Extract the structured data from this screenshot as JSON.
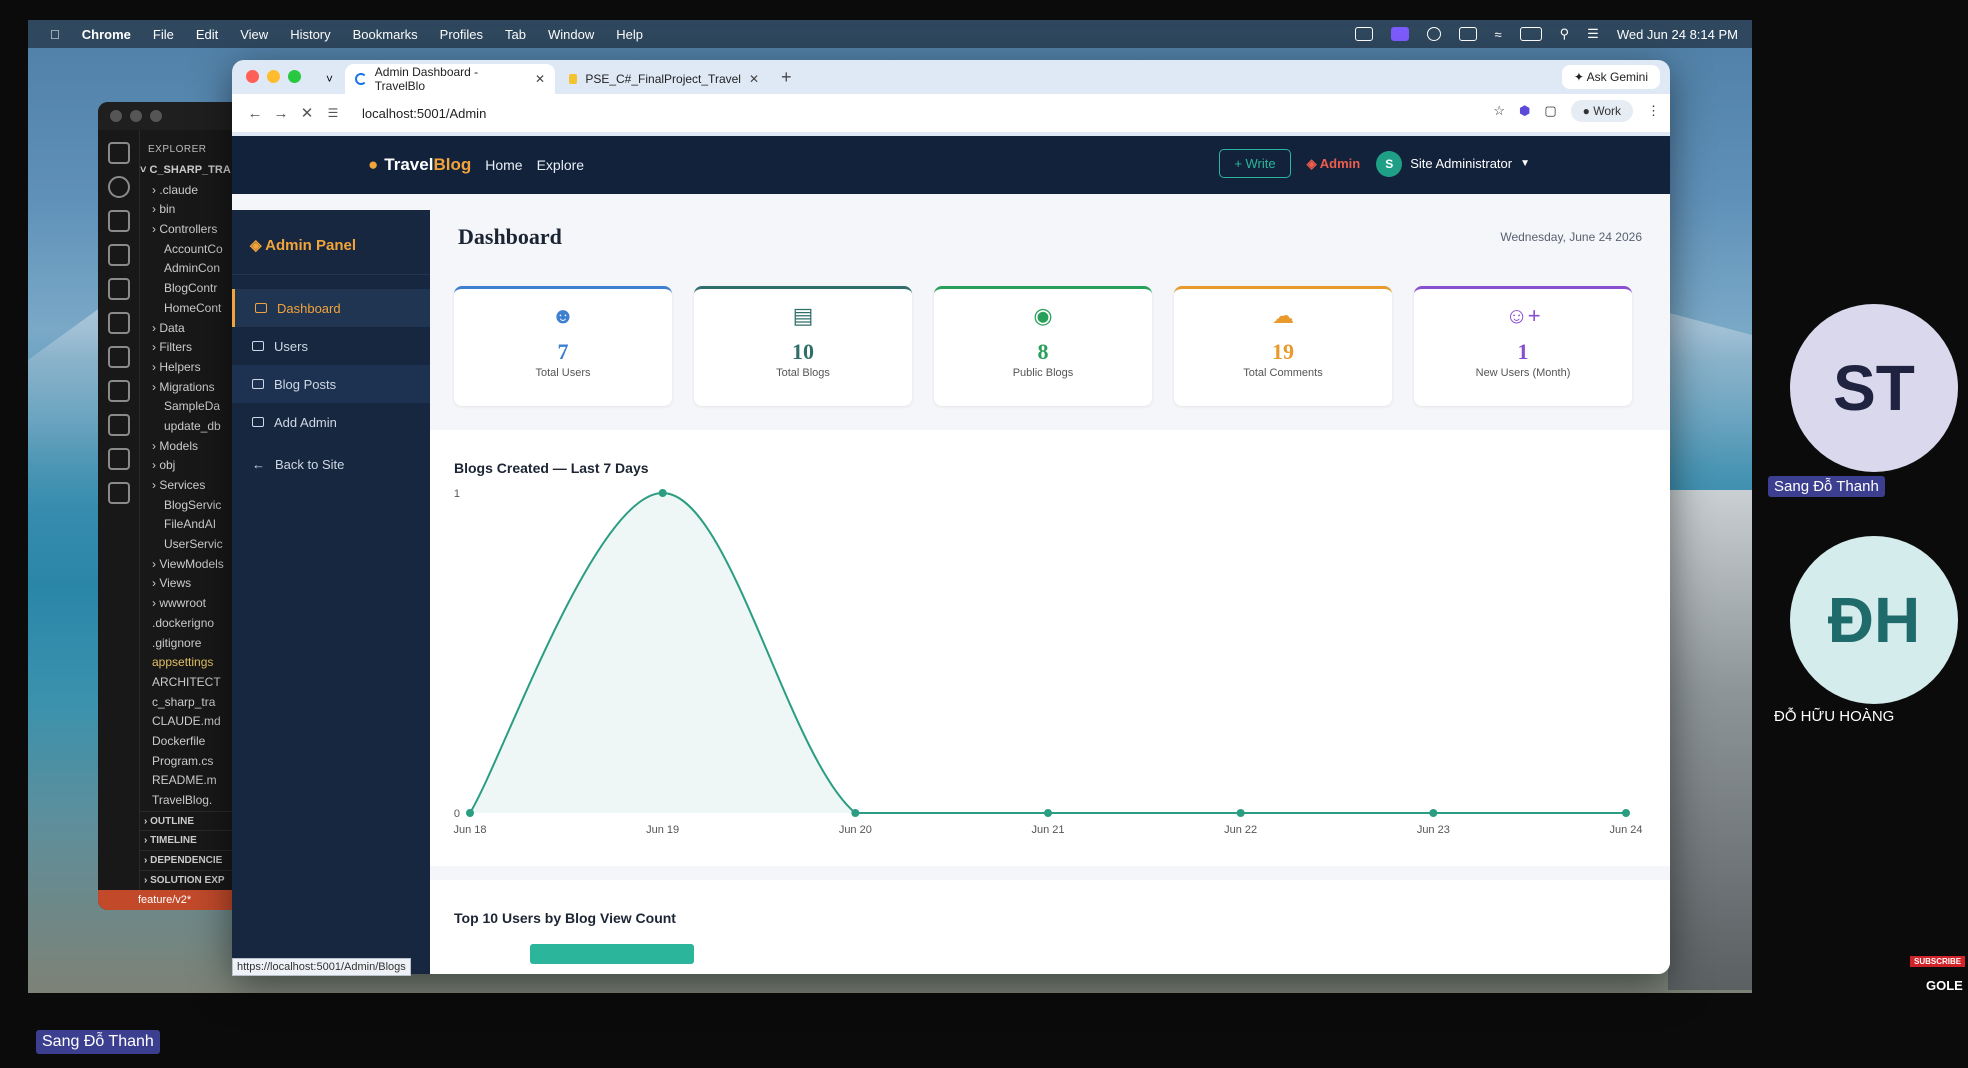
{
  "menubar": {
    "app": "Chrome",
    "items": [
      "File",
      "Edit",
      "View",
      "History",
      "Bookmarks",
      "Profiles",
      "Tab",
      "Window",
      "Help"
    ],
    "datetime": "Wed Jun 24  8:14 PM"
  },
  "vscode": {
    "explorer_label": "EXPLORER",
    "root": "C_SHARP_TRA",
    "items": [
      ".claude",
      "bin",
      "Controllers",
      "AccountCo",
      "AdminCon",
      "BlogContr",
      "HomeCont",
      "Data",
      "Filters",
      "Helpers",
      "Migrations",
      "SampleDa",
      "update_db",
      "Models",
      "obj",
      "Services",
      "BlogServic",
      "FileAndAI",
      "UserServic",
      "ViewModels",
      "Views",
      "wwwroot",
      ".dockerigno",
      ".gitignore",
      "appsettings",
      "ARCHITECT",
      "c_sharp_tra",
      "CLAUDE.md",
      "Dockerfile",
      "Program.cs",
      "README.m",
      "TravelBlog."
    ],
    "sections": [
      "OUTLINE",
      "TIMELINE",
      "DEPENDENCIE",
      "SOLUTION EXP"
    ],
    "branch": "feature/v2*"
  },
  "chrome": {
    "tabs": [
      {
        "label": "Admin Dashboard - TravelBlo"
      },
      {
        "label": "PSE_C#_FinalProject_Travel"
      }
    ],
    "ask_gemini": "Ask Gemini",
    "url": "localhost:5001/Admin",
    "profile": "Work",
    "status_url": "https://localhost:5001/Admin/Blogs"
  },
  "site": {
    "logo_travel": "Travel",
    "logo_blog": "Blog",
    "nav": [
      "Home",
      "Explore"
    ],
    "write": "+ Write",
    "admin": "Admin",
    "avatar_initial": "S",
    "user": "Site Administrator"
  },
  "sidebar": {
    "title": "Admin Panel",
    "items": [
      {
        "label": "Dashboard"
      },
      {
        "label": "Users"
      },
      {
        "label": "Blog Posts"
      },
      {
        "label": "Add Admin"
      },
      {
        "label": "Back to Site"
      }
    ]
  },
  "dashboard": {
    "title": "Dashboard",
    "date": "Wednesday, June 24 2026",
    "cards": [
      {
        "value": "7",
        "label": "Total Users",
        "color": "#3f7fd0"
      },
      {
        "value": "10",
        "label": "Total Blogs",
        "color": "#2f6e6a"
      },
      {
        "value": "8",
        "label": "Public Blogs",
        "color": "#27a05a"
      },
      {
        "value": "19",
        "label": "Total Comments",
        "color": "#e89a2c"
      },
      {
        "value": "1",
        "label": "New Users (Month)",
        "color": "#8a4fd0"
      }
    ],
    "top_users_title": "Top 10 Users by Blog View Count"
  },
  "chart_data": {
    "type": "area",
    "title": "Blogs Created — Last 7 Days",
    "categories": [
      "Jun 18",
      "Jun 19",
      "Jun 20",
      "Jun 21",
      "Jun 22",
      "Jun 23",
      "Jun 24"
    ],
    "values": [
      0,
      1,
      0,
      0,
      0,
      0,
      0
    ],
    "ylim": [
      0,
      1
    ],
    "yticks": [
      "0",
      "1"
    ],
    "color": "#2a9d82",
    "grid": false
  },
  "participants": [
    {
      "initials": "ST",
      "name": "Sang Đỗ Thanh"
    },
    {
      "initials": "ĐH",
      "name": "ĐỖ HỮU HOÀNG"
    }
  ],
  "bottom_name": "Sang Đỗ Thanh",
  "watermark": {
    "subscribe": "SUBSCRIBE",
    "brand": "GOLE"
  }
}
